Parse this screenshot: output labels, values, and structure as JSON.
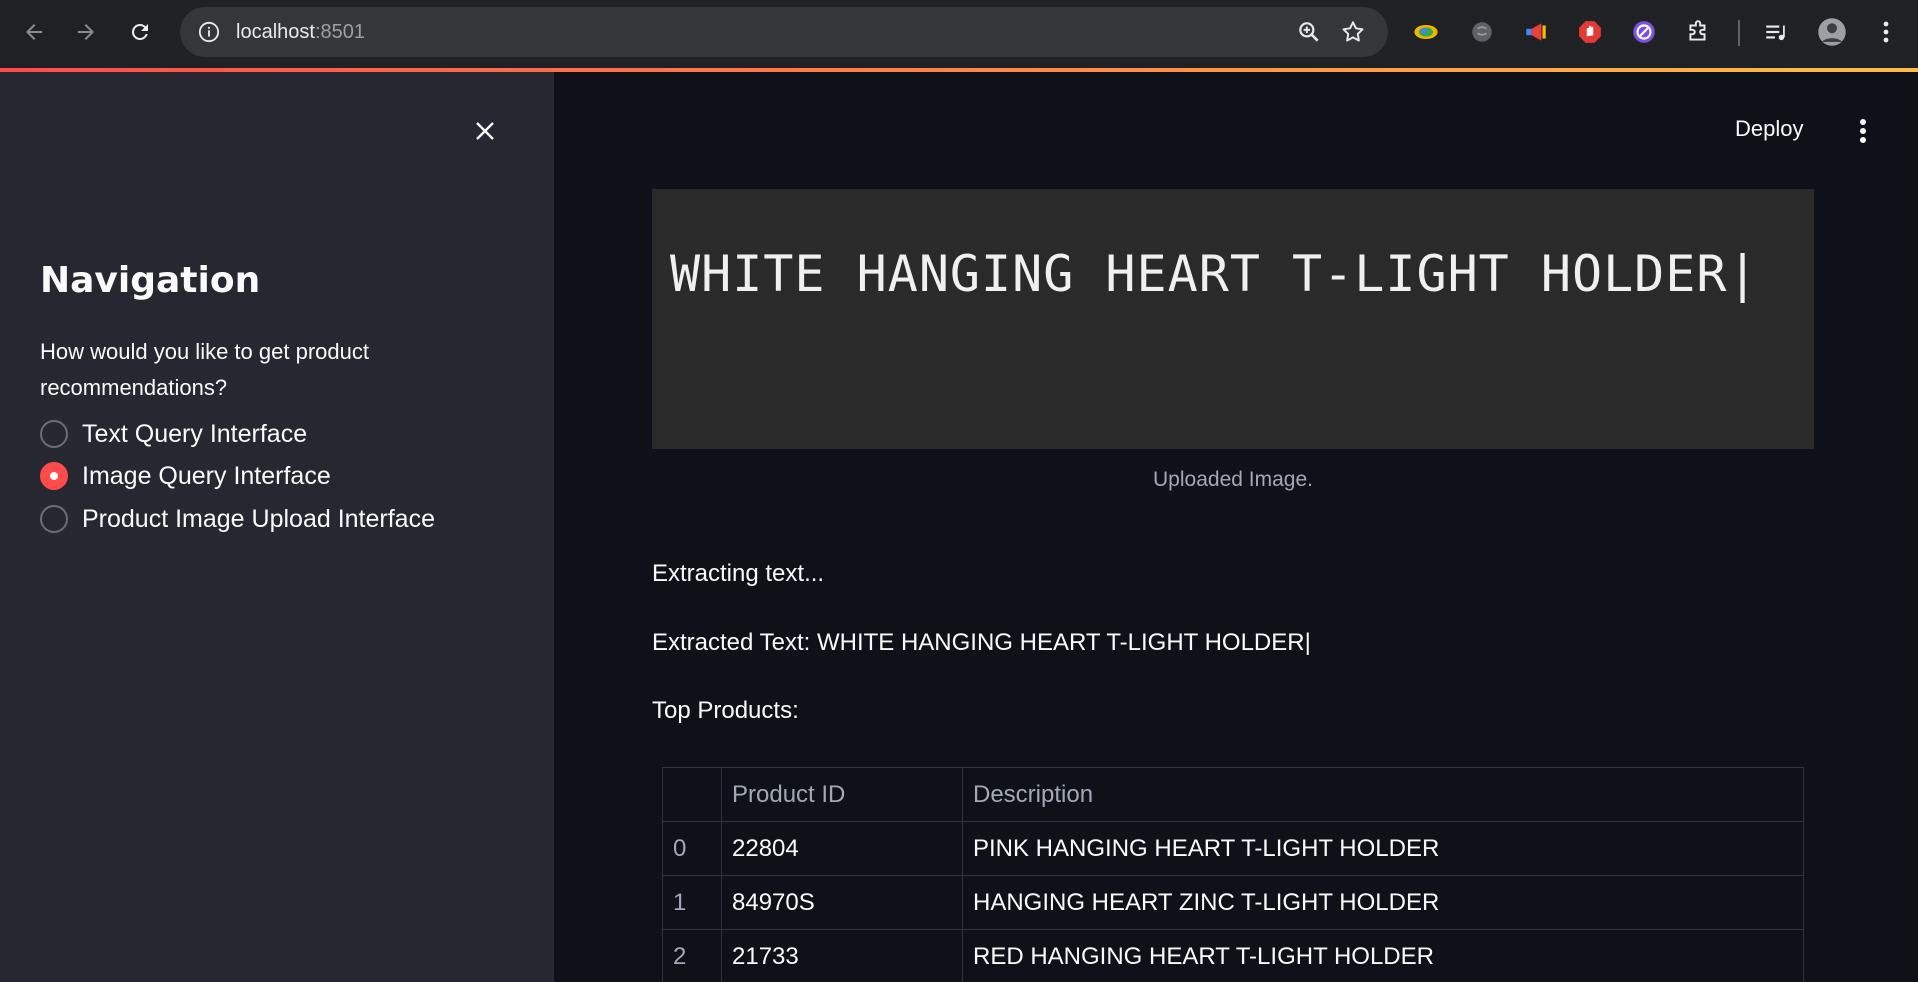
{
  "browser": {
    "url_host": "localhost",
    "url_port": ":8501"
  },
  "sidebar": {
    "title": "Navigation",
    "radio_label": "How would you like to get product recommendations?",
    "options": [
      {
        "label": "Text Query Interface",
        "checked": false
      },
      {
        "label": "Image Query Interface",
        "checked": true
      },
      {
        "label": "Product Image Upload Interface",
        "checked": false
      }
    ]
  },
  "header": {
    "deploy_label": "Deploy"
  },
  "main": {
    "image_text": "WHITE HANGING HEART T-LIGHT HOLDER|",
    "image_caption": "Uploaded Image.",
    "extracting": "Extracting text...",
    "extracted": "Extracted Text: WHITE HANGING HEART T-LIGHT HOLDER|",
    "top_products": "Top Products:",
    "table": {
      "headers": [
        "",
        "Product ID",
        "Description"
      ],
      "rows": [
        {
          "index": "0",
          "id": "22804",
          "desc": "PINK HANGING HEART T-LIGHT HOLDER"
        },
        {
          "index": "1",
          "id": "84970S",
          "desc": "HANGING HEART ZINC T-LIGHT HOLDER"
        },
        {
          "index": "2",
          "id": "21733",
          "desc": "RED HANGING HEART T-LIGHT HOLDER"
        }
      ]
    }
  },
  "colors": {
    "accent": "#ff4b4b",
    "sidebar_bg": "#262730",
    "main_bg": "#0e1117"
  }
}
